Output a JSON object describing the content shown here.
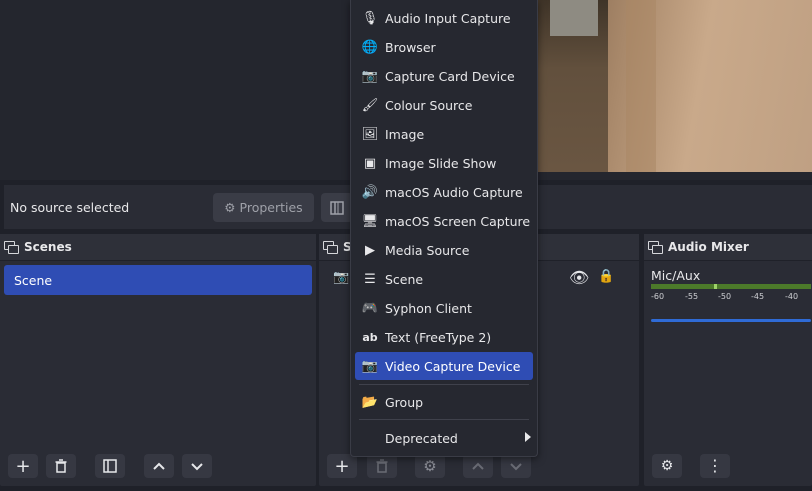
{
  "toolbar": {
    "no_source": "No source selected",
    "properties_label": "Properties"
  },
  "scenes": {
    "title": "Scenes",
    "items": [
      "Scene"
    ]
  },
  "sources": {
    "title": "S"
  },
  "mixer": {
    "title": "Audio Mixer",
    "channel": "Mic/Aux",
    "scale": [
      "-60",
      "-55",
      "-50",
      "-45",
      "-40"
    ]
  },
  "menu": {
    "items": [
      {
        "label": "Audio Input Capture",
        "icon": "microphone-icon"
      },
      {
        "label": "Browser",
        "icon": "globe-icon"
      },
      {
        "label": "Capture Card Device",
        "icon": "camera-icon"
      },
      {
        "label": "Colour Source",
        "icon": "paintbrush-icon"
      },
      {
        "label": "Image",
        "icon": "image-icon"
      },
      {
        "label": "Image Slide Show",
        "icon": "slideshow-icon"
      },
      {
        "label": "macOS Audio Capture",
        "icon": "speaker-icon"
      },
      {
        "label": "macOS Screen Capture",
        "icon": "monitor-icon"
      },
      {
        "label": "Media Source",
        "icon": "play-icon"
      },
      {
        "label": "Scene",
        "icon": "list-icon"
      },
      {
        "label": "Syphon Client",
        "icon": "gamepad-icon"
      },
      {
        "label": "Text (FreeType 2)",
        "icon": "text-icon"
      },
      {
        "label": "Video Capture Device",
        "icon": "camera-icon"
      }
    ],
    "group": "Group",
    "deprecated": "Deprecated",
    "selected_index": 12
  },
  "colors": {
    "accent": "#2f4db4",
    "bg": "#1f2129",
    "panel": "#2a2c35"
  }
}
